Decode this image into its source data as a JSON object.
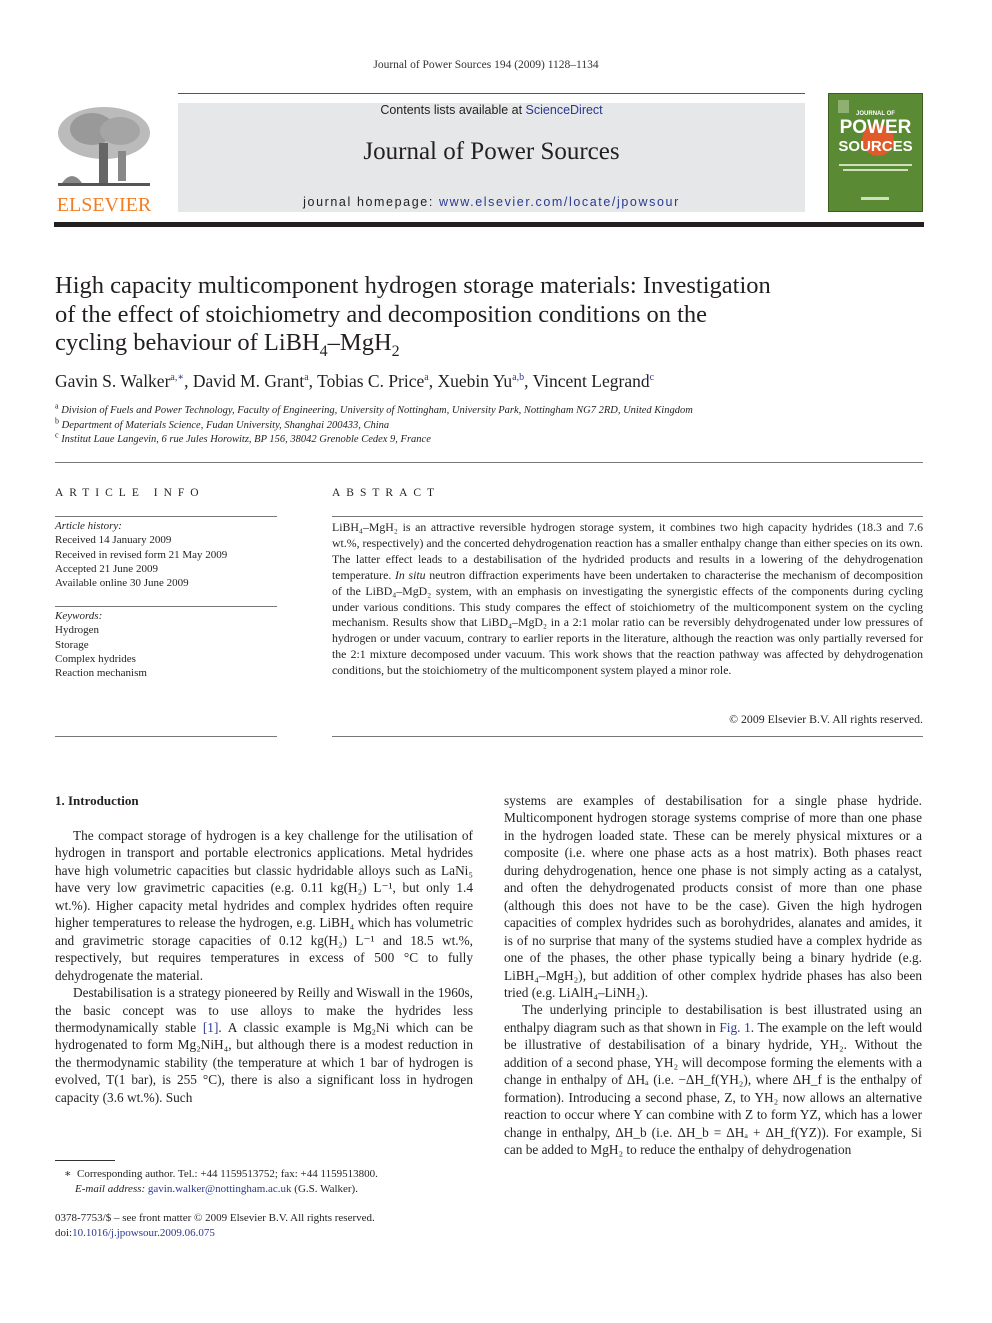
{
  "running_head": "Journal of Power Sources 194 (2009) 1128–1134",
  "banner": {
    "contents_prefix": "Contents lists available at ",
    "contents_link": "ScienceDirect",
    "journal_title": "Journal of Power Sources",
    "homepage_prefix": "journal homepage: ",
    "homepage_url": "www.elsevier.com/locate/jpowsour",
    "publisher_logo_text": "ELSEVIER",
    "cover": {
      "line1": "JOURNAL OF",
      "line2": "POWER",
      "line3": "SOURCES"
    }
  },
  "colors": {
    "link": "#2b3990",
    "elsevier_orange": "#f07e26",
    "banner_gray": "#e6e7e8",
    "cover_green": "#5a8a33",
    "cover_sun": "#e05a2a"
  },
  "article": {
    "title_line1": "High capacity multicomponent hydrogen storage materials: Investigation",
    "title_line2": "of the effect of stoichiometry and decomposition conditions on the",
    "title_line3_prefix": "cycling behaviour of LiBH",
    "title_sub1": "4",
    "title_mid": "–MgH",
    "title_sub2": "2",
    "authors": [
      {
        "name": "Gavin S. Walker",
        "aff": "a,∗"
      },
      {
        "name": "David M. Grant",
        "aff": "a"
      },
      {
        "name": "Tobias C. Price",
        "aff": "a"
      },
      {
        "name": "Xuebin Yu",
        "aff": "a,b"
      },
      {
        "name": "Vincent Legrand",
        "aff": "c"
      }
    ],
    "affiliations": [
      {
        "key": "a",
        "text": "Division of Fuels and Power Technology, Faculty of Engineering, University of Nottingham, University Park, Nottingham NG7 2RD, United Kingdom"
      },
      {
        "key": "b",
        "text": "Department of Materials Science, Fudan University, Shanghai 200433, China"
      },
      {
        "key": "c",
        "text": "Institut Laue Langevin, 6 rue Jules Horowitz, BP 156, 38042 Grenoble Cedex 9, France"
      }
    ]
  },
  "article_info": {
    "heading": "ARTICLE INFO",
    "history_label": "Article history:",
    "history": [
      "Received 14 January 2009",
      "Received in revised form 21 May 2009",
      "Accepted 21 June 2009",
      "Available online 30 June 2009"
    ],
    "keywords_label": "Keywords:",
    "keywords": [
      "Hydrogen",
      "Storage",
      "Complex hydrides",
      "Reaction mechanism"
    ]
  },
  "abstract": {
    "heading": "ABSTRACT",
    "parts": {
      "p1": "LiBH₄–MgH₂ is an attractive reversible hydrogen storage system, it combines two high capacity hydrides (18.3 and 7.6 wt.%, respectively) and the concerted dehydrogenation reaction has a smaller enthalpy change than either species on its own. The latter effect leads to a destabilisation of the hydrided products and results in a lowering of the dehydrogenation temperature. ",
      "italic": "In situ",
      "p2": " neutron diffraction experiments have been undertaken to characterise the mechanism of decomposition of the LiBD₄–MgD₂ system, with an emphasis on investigating the synergistic effects of the components during cycling under various conditions. This study compares the effect of stoichiometry of the multicomponent system on the cycling mechanism. Results show that LiBD₄–MgD₂ in a 2:1 molar ratio can be reversibly dehydrogenated under low pressures of hydrogen or under vacuum, contrary to earlier reports in the literature, although the reaction was only partially reversed for the 2:1 mixture decomposed under vacuum. This work shows that the reaction pathway was affected by dehydrogenation conditions, but the stoichiometry of the multicomponent system played a minor role."
    },
    "copyright": "© 2009 Elsevier B.V. All rights reserved."
  },
  "body": {
    "section_heading": "1.  Introduction",
    "left_p1": "The compact storage of hydrogen is a key challenge for the utilisation of hydrogen in transport and portable electronics applications. Metal hydrides have high volumetric capacities but classic hydridable alloys such as LaNi₅ have very low gravimetric capacities (e.g. 0.11 kg(H₂) L⁻¹, but only 1.4 wt.%). Higher capacity metal hydrides and complex hydrides often require higher temperatures to release the hydrogen, e.g. LiBH₄ which has volumetric and gravimetric storage capacities of 0.12 kg(H₂) L⁻¹ and 18.5 wt.%, respectively, but requires temperatures in excess of 500 °C to fully dehydrogenate the material.",
    "left_p2_a": "Destabilisation is a strategy pioneered by Reilly and Wiswall in the 1960s, the basic concept was to use alloys to make the hydrides less thermodynamically stable ",
    "left_p2_ref": "[1]",
    "left_p2_b": ". A classic example is Mg₂Ni which can be hydrogenated to form Mg₂NiH₄, but although there is a modest reduction in the thermodynamic stability (the temperature at which 1 bar of hydrogen is evolved, T(1 bar), is 255 °C), there is also a significant loss in hydrogen capacity (3.6 wt.%). Such",
    "right_p1": "systems are examples of destabilisation for a single phase hydride. Multicomponent hydrogen storage systems comprise of more than one phase in the hydrogen loaded state. These can be merely physical mixtures or a composite (i.e. where one phase acts as a host matrix). Both phases react during dehydrogenation, hence one phase is not simply acting as a catalyst, and often the dehydrogenated products consist of more than one phase (although this does not have to be the case). Given the high hydrogen capacities of complex hydrides such as borohydrides, alanates and amides, it is of no surprise that many of the systems studied have a complex hydride as one of the phases, the other phase typically being a binary hydride (e.g. LiBH₄–MgH₂), but addition of other complex hydride phases has also been tried (e.g. LiAlH₄–LiNH₂).",
    "right_p2_a": "The underlying principle to destabilisation is best illustrated using an enthalpy diagram such as that shown in ",
    "right_p2_ref": "Fig. 1",
    "right_p2_b": ". The example on the left would be illustrative of destabilisation of a binary hydride, YH₂. Without the addition of a second phase, YH₂ will decompose forming the elements with a change in enthalpy of ΔHₐ (i.e. −ΔH_f(YH₂), where ΔH_f is the enthalpy of formation). Introducing a second phase, Z, to YH₂ now allows an alternative reaction to occur where Y can combine with Z to form YZ, which has a lower change in enthalpy, ΔH_b (i.e. ΔH_b = ΔHₐ + ΔH_f(YZ)). For example, Si can be added to MgH₂ to reduce the enthalpy of dehydrogenation"
  },
  "footnotes": {
    "star": "∗",
    "corresponding": "Corresponding author. Tel.: +44 1159513752; fax: +44 1159513800.",
    "email_label": "E-mail address: ",
    "email": "gavin.walker@nottingham.ac.uk",
    "email_suffix": " (G.S. Walker).",
    "front_matter": "0378-7753/$ – see front matter © 2009 Elsevier B.V. All rights reserved.",
    "doi_label": "doi:",
    "doi": "10.1016/j.jpowsour.2009.06.075"
  }
}
